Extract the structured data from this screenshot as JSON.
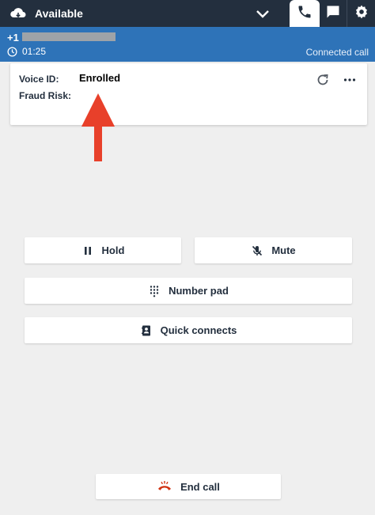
{
  "topbar": {
    "status_label": "Available"
  },
  "call": {
    "number_prefix": "+1",
    "timer": "01:25",
    "state": "Connected call"
  },
  "voice_id": {
    "label": "Voice ID:",
    "value": "Enrolled",
    "fraud_label": "Fraud Risk:"
  },
  "actions": {
    "hold": "Hold",
    "mute": "Mute",
    "number_pad": "Number pad",
    "quick_connects": "Quick connects",
    "end_call": "End call"
  },
  "colors": {
    "topbar": "#232f3e",
    "callbar": "#2e73b8",
    "annotation_arrow": "#e8402a",
    "end_call_icon": "#d13212"
  }
}
